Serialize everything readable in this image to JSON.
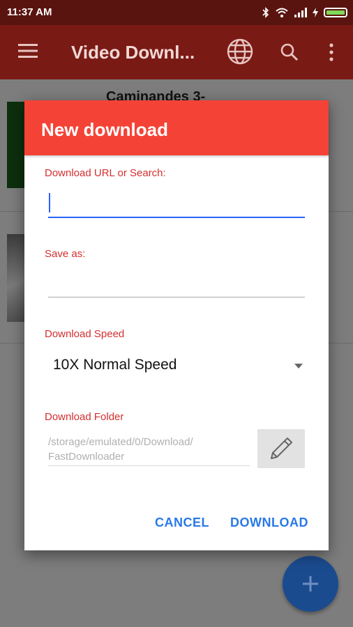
{
  "status_bar": {
    "time": "11:37 AM"
  },
  "app_bar": {
    "title": "Video Downl..."
  },
  "list": {
    "items": [
      {
        "title": "Caminandes 3-"
      }
    ]
  },
  "dialog": {
    "title": "New download",
    "url": {
      "label": "Download URL or Search:",
      "value": ""
    },
    "save_as": {
      "label": "Save as:",
      "value": ""
    },
    "speed": {
      "label": "Download Speed",
      "selected": "10X Normal Speed"
    },
    "folder": {
      "label": "Download Folder",
      "path_line1": "/storage/emulated/0/Download/",
      "path_line2": "FastDownloader"
    },
    "cancel_label": "CANCEL",
    "download_label": "DOWNLOAD"
  },
  "colors": {
    "dialog_header": "#f44336",
    "label_red": "#d32f2f",
    "action_blue": "#2979e8",
    "focus_blue": "#2962ff",
    "app_bar_dimmed": "#7a1a14",
    "fab_dimmed": "#1b4b8f"
  },
  "icons": [
    "bluetooth-icon",
    "wifi-icon",
    "signal-icon",
    "charging-icon",
    "battery-icon",
    "menu-icon",
    "globe-icon",
    "search-icon",
    "more-vert-icon",
    "pencil-icon",
    "plus-icon",
    "dropdown-arrow-icon"
  ]
}
